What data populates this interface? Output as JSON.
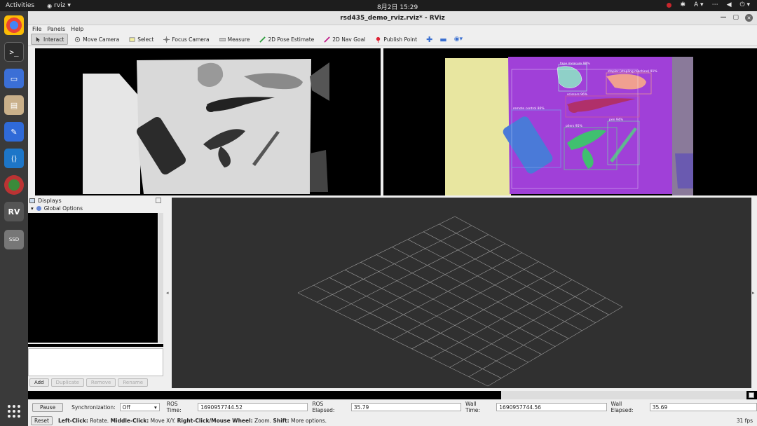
{
  "topbar": {
    "activities": "Activities",
    "app_name": "rviz",
    "clock": "8月2日 15:29",
    "keyboard": "A"
  },
  "window": {
    "title": "rsd435_demo_rviz.rviz* - RViz"
  },
  "menu": [
    "File",
    "Panels",
    "Help"
  ],
  "toolbar": {
    "tools": [
      {
        "label": "Interact",
        "icon": "interact-icon"
      },
      {
        "label": "Move Camera",
        "icon": "move-camera-icon"
      },
      {
        "label": "Select",
        "icon": "select-icon"
      },
      {
        "label": "Focus Camera",
        "icon": "focus-camera-icon"
      },
      {
        "label": "Measure",
        "icon": "measure-icon"
      },
      {
        "label": "2D Pose Estimate",
        "icon": "pose-estimate-icon"
      },
      {
        "label": "2D Nav Goal",
        "icon": "nav-goal-icon"
      },
      {
        "label": "Publish Point",
        "icon": "publish-point-icon"
      }
    ]
  },
  "displays": {
    "title": "Displays",
    "global_options": "Global Options",
    "buttons": {
      "add": "Add",
      "duplicate": "Duplicate",
      "remove": "Remove",
      "rename": "Rename"
    }
  },
  "detections": [
    {
      "label": "tape measure 98%",
      "color": "#8fd0c8"
    },
    {
      "label": "stapler (stapling machine) 91%",
      "color": "#f0a090"
    },
    {
      "label": "scissors 96%",
      "color": "#b0306a"
    },
    {
      "label": "remote control 86%",
      "color": "#4a7ad8"
    },
    {
      "label": "pliers 95%",
      "color": "#40c070"
    },
    {
      "label": "pen 94%",
      "color": "#60b890"
    }
  ],
  "colors": {
    "mask_purple": "#a040d8",
    "paper_yellow": "#e8e6a0"
  },
  "timebar": {
    "pause": "Pause",
    "sync_label": "Synchronization:",
    "sync_value": "Off",
    "ros_time_label": "ROS Time:",
    "ros_time": "1690957744.52",
    "ros_elapsed_label": "ROS Elapsed:",
    "ros_elapsed": "35.79",
    "wall_time_label": "Wall Time:",
    "wall_time": "1690957744.56",
    "wall_elapsed_label": "Wall Elapsed:",
    "wall_elapsed": "35.69"
  },
  "statusbar": {
    "reset": "Reset",
    "hint_left_key": "Left-Click:",
    "hint_left": "Rotate.",
    "hint_middle_key": "Middle-Click:",
    "hint_middle": "Move X/Y.",
    "hint_right_key": "Right-Click/Mouse Wheel:",
    "hint_right": "Zoom.",
    "hint_shift_key": "Shift:",
    "hint_shift": "More options.",
    "fps": "31 fps"
  }
}
